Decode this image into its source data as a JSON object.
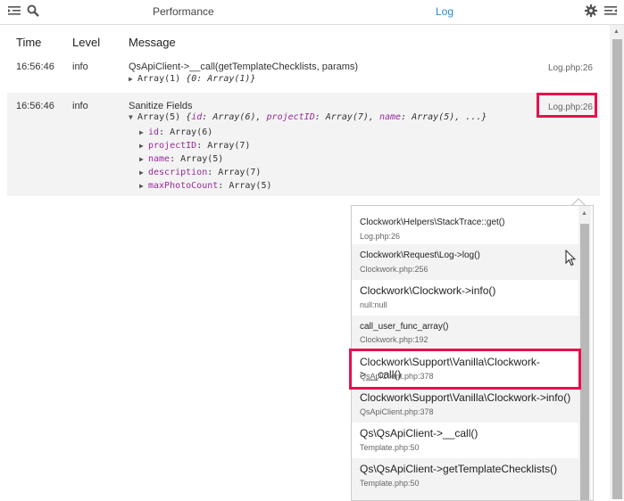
{
  "toolbar": {
    "left_icons": [
      "sidebar-toggle-icon",
      "search-icon"
    ],
    "tabs": [
      {
        "label": "Performance",
        "active": false
      },
      {
        "label": "Log",
        "active": true
      }
    ],
    "right_icons": [
      "gear-icon",
      "details-toggle-icon"
    ]
  },
  "columns": {
    "time": "Time",
    "level": "Level",
    "message": "Message"
  },
  "rows": [
    {
      "time": "16:56:46",
      "level": "info",
      "message": "QsApiClient->__call(getTemplateChecklists, params)",
      "dump_head": "Array(1)",
      "dump_preview": "{0: Array(1)}",
      "file": "Log.php:26"
    },
    {
      "time": "16:56:46",
      "level": "info",
      "message": "Sanitize Fields",
      "dump_head": "Array(5)",
      "dump_preview": "{id: Array(6), projectID: Array(7), name: Array(5), ...}",
      "dump_preview_parts": [
        "{",
        "id",
        ": Array(6), ",
        "projectID",
        ": Array(7), ",
        "name",
        ": Array(5), ...}"
      ],
      "children": [
        {
          "key": "id",
          "value": "Array(6)"
        },
        {
          "key": "projectID",
          "value": "Array(7)"
        },
        {
          "key": "name",
          "value": "Array(5)"
        },
        {
          "key": "description",
          "value": "Array(7)"
        },
        {
          "key": "maxPhotoCount",
          "value": "Array(5)"
        }
      ],
      "file": "Log.php:26"
    }
  ],
  "stack_trace": [
    {
      "call": "Clockwork\\Helpers\\StackTrace::get()",
      "file": "Log.php:26"
    },
    {
      "call": "Clockwork\\Request\\Log->log()",
      "file": "Clockwork.php:256"
    },
    {
      "call": "Clockwork\\Clockwork->info()",
      "file": "null:null"
    },
    {
      "call": "call_user_func_array()",
      "file": "Clockwork.php:192"
    },
    {
      "call": "Clockwork\\Support\\Vanilla\\Clockwork->__call()",
      "file": "QsApiClient.php:378"
    },
    {
      "call": "Clockwork\\Support\\Vanilla\\Clockwork->info()",
      "file": "QsApiClient.php:378"
    },
    {
      "call": "Qs\\QsApiClient->__call()",
      "file": "Template.php:50"
    },
    {
      "call": "Qs\\QsApiClient->getTemplateChecklists()",
      "file": "Template.php:50"
    }
  ],
  "colors": {
    "accent": "#258cd1",
    "highlight": "#e8104d",
    "key": "#9b2a9b"
  }
}
